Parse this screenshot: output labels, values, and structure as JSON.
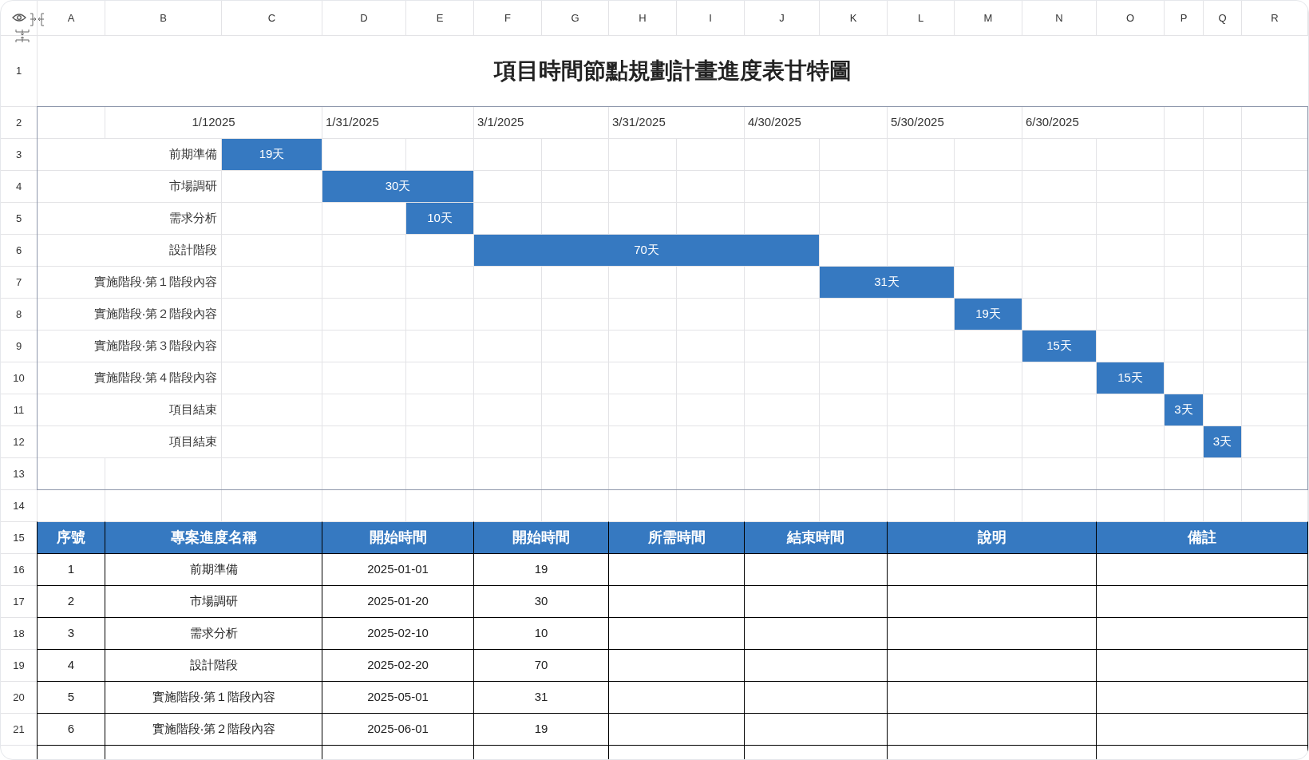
{
  "column_headers": [
    "A",
    "B",
    "C",
    "D",
    "E",
    "F",
    "G",
    "H",
    "I",
    "J",
    "K",
    "L",
    "M",
    "N",
    "O",
    "P",
    "Q",
    "R"
  ],
  "row_numbers": [
    "1",
    "2",
    "3",
    "4",
    "5",
    "6",
    "7",
    "8",
    "9",
    "10",
    "11",
    "12",
    "13",
    "14",
    "15",
    "16",
    "17",
    "18",
    "19",
    "20",
    "21"
  ],
  "title": "項目時間節點規劃計畫進度表甘特圖",
  "timeline_dates": [
    "1/12025",
    "1/31/2025",
    "3/1/2025",
    "3/31/2025",
    "4/30/2025",
    "5/30/2025",
    "6/30/2025"
  ],
  "tasks": [
    {
      "name": "前期準備",
      "duration": "19天"
    },
    {
      "name": "市場調研",
      "duration": "30天"
    },
    {
      "name": "需求分析",
      "duration": "10天"
    },
    {
      "name": "設計階段",
      "duration": "70天"
    },
    {
      "name": "實施階段‧第１階段內容",
      "duration": "31天"
    },
    {
      "name": "實施階段‧第２階段內容",
      "duration": "19天"
    },
    {
      "name": "實施階段‧第３階段內容",
      "duration": "15天"
    },
    {
      "name": "實施階段‧第４階段內容",
      "duration": "15天"
    },
    {
      "name": "項目結束",
      "duration": "3天"
    },
    {
      "name": "項目結束",
      "duration": "3天"
    }
  ],
  "table": {
    "columns": [
      "序號",
      "專案進度名稱",
      "開始時間",
      "開始時間",
      "所需時間",
      "結束時間",
      "說明",
      "備註"
    ],
    "rows": [
      {
        "number": "1",
        "name": "前期準備",
        "start": "2025-01-01",
        "days": "19"
      },
      {
        "number": "2",
        "name": "市場調研",
        "start": "2025-01-20",
        "days": "30"
      },
      {
        "number": "3",
        "name": "需求分析",
        "start": "2025-02-10",
        "days": "10"
      },
      {
        "number": "4",
        "name": "設計階段",
        "start": "2025-02-20",
        "days": "70"
      },
      {
        "number": "5",
        "name": "實施階段‧第１階段內容",
        "start": "2025-05-01",
        "days": "31"
      },
      {
        "number": "6",
        "name": "實施階段‧第２階段內容",
        "start": "2025-06-01",
        "days": "19"
      }
    ]
  }
}
